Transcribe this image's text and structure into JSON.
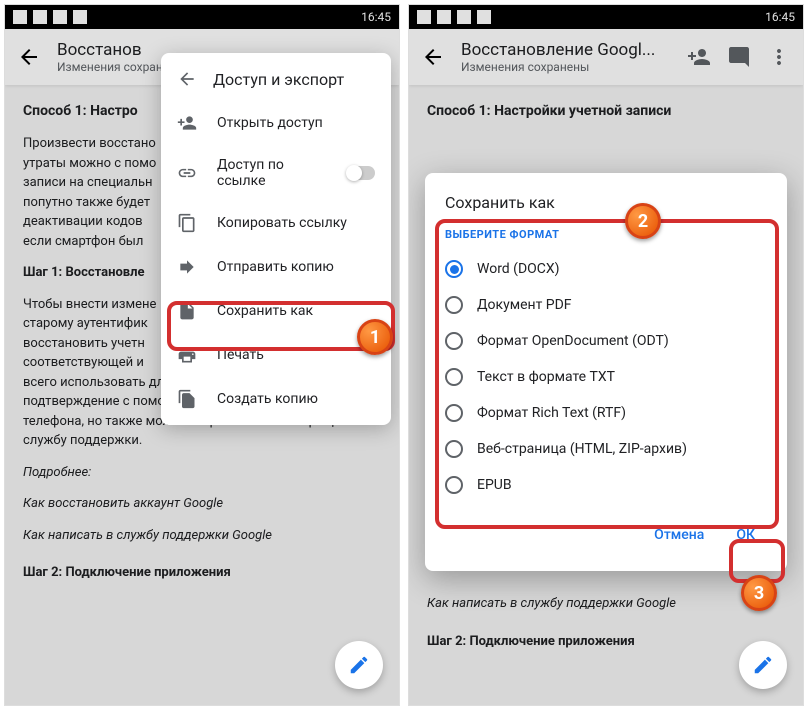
{
  "statusbar": {
    "time": "16:45"
  },
  "appbar": {
    "title": "Восстановление Googl...",
    "title_short": "Восстанов",
    "subtitle": "Изменения сохранены"
  },
  "doc": {
    "heading": "Способ 1: Настройки учетной записи",
    "heading_short": "Способ 1: Настро",
    "para1_short": "Произвести восстано\nутраты можно с помо\nзаписи на специальн\nпопутно также будет\nдеактивации кодов\nесли смартфон был",
    "step1_short": "Шаг 1: Восстановле",
    "para2_short": "Чтобы внести измене\nстарому аутентифик\nвосстановить учетн\nсоответствующей и\nвсего использовать для этих целей аварийные коды или\nподтверждение с помощью временного кода на номер\nтелефона, но также может потребоваться и обращение в\nслужбу поддержки.",
    "more": "Подробнее:",
    "link1": "Как восстановить аккаунт Google",
    "link2": "Как написать в службу поддержки Google",
    "step2": "Шаг 2: Подключение приложения"
  },
  "menu": {
    "header": "Доступ и экспорт",
    "items": [
      "Открыть доступ",
      "Доступ по ссылке",
      "Копировать ссылку",
      "Отправить копию",
      "Сохранить как",
      "Печать",
      "Создать копию"
    ]
  },
  "dialog": {
    "title": "Сохранить как",
    "label": "ВЫБЕРИТЕ ФОРМАТ",
    "options": [
      "Word (DOCX)",
      "Документ PDF",
      "Формат OpenDocument (ODT)",
      "Текст в формате TXT",
      "Формат Rich Text (RTF)",
      "Веб-страница (HTML, ZIP-архив)",
      "EPUB"
    ],
    "cancel": "Отмена",
    "ok": "ОК"
  },
  "badges": {
    "one": "1",
    "two": "2",
    "three": "3"
  }
}
